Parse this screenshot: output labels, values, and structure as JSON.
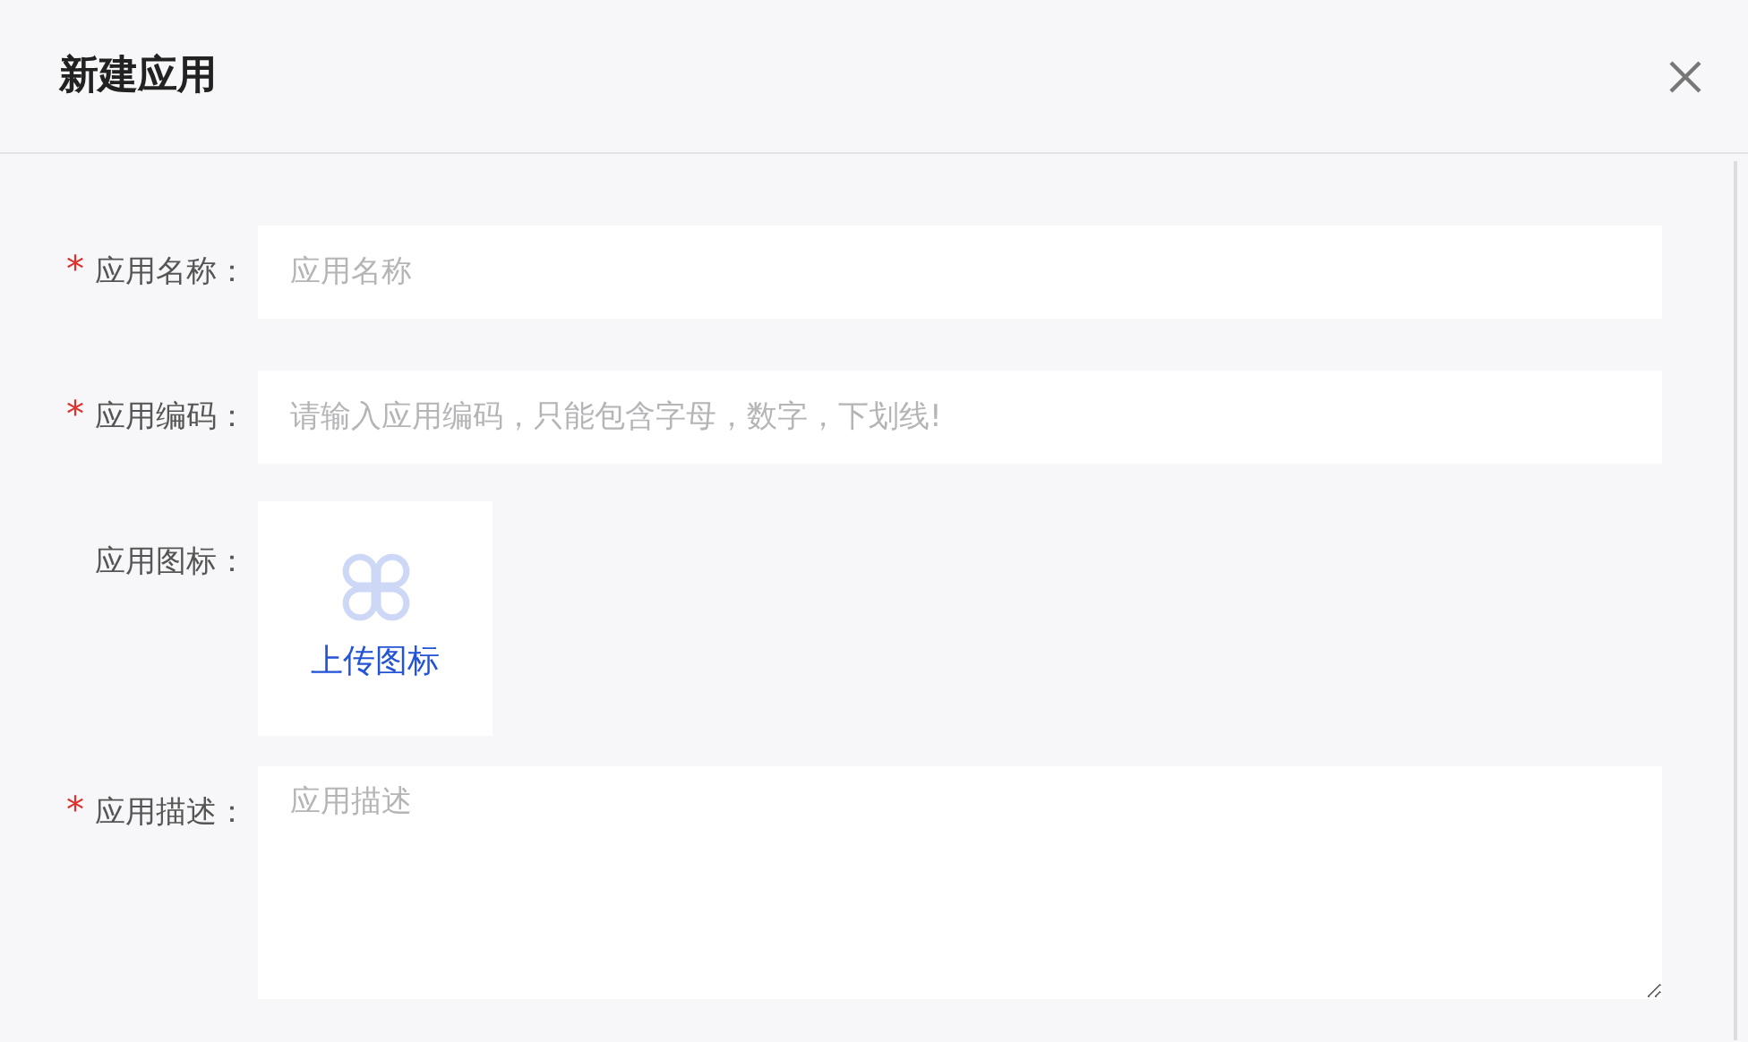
{
  "dialog": {
    "title": "新建应用"
  },
  "required_mark": "*",
  "fields": [
    {
      "kind": "input",
      "label": "应用名称：",
      "required": true,
      "placeholder": "应用名称"
    },
    {
      "kind": "input",
      "label": "应用编码：",
      "required": true,
      "placeholder": "请输入应用编码，只能包含字母，数字，下划线!"
    },
    {
      "kind": "upload",
      "label": "应用图标：",
      "required": false,
      "upload_text": "上传图标"
    },
    {
      "kind": "textarea",
      "label": "应用描述：",
      "required": true,
      "placeholder": "应用描述"
    }
  ]
}
